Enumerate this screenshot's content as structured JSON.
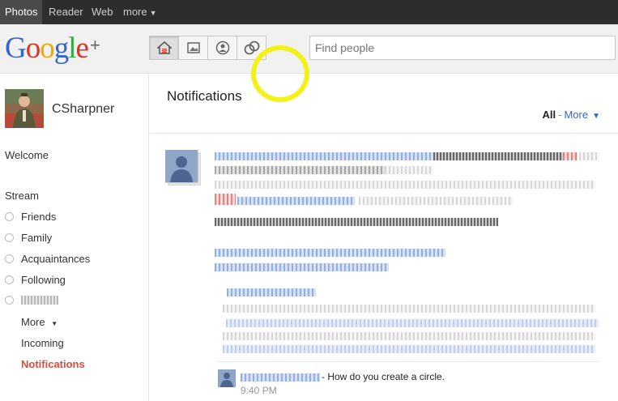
{
  "topbar": {
    "items": [
      {
        "label": "Photos",
        "active": true
      },
      {
        "label": "Reader",
        "active": false
      },
      {
        "label": "Web",
        "active": false
      },
      {
        "label": "more",
        "active": false
      }
    ]
  },
  "header": {
    "logo": {
      "g1": "G",
      "o1": "o",
      "o2": "o",
      "g2": "g",
      "l": "l",
      "e": "e",
      "plus": "+"
    },
    "nav_icons": [
      "home-icon",
      "photos-icon",
      "profile-icon",
      "circles-icon"
    ],
    "active_nav": "home-icon",
    "search_placeholder": "Find people",
    "highlight_color": "#f2f218"
  },
  "sidebar": {
    "profile_name": "CSharpner",
    "welcome": "Welcome",
    "stream": "Stream",
    "circles": [
      "Friends",
      "Family",
      "Acquaintances",
      "Following"
    ],
    "more": "More",
    "incoming": "Incoming",
    "notifications": "Notifications"
  },
  "main": {
    "title": "Notifications",
    "filter_all": "All",
    "filter_sep": "-",
    "filter_more": "More",
    "comment_text": "- How do you create a circle.",
    "comment_time": "9:40 PM"
  },
  "colors": {
    "accent_red": "#dd4b39",
    "link_blue": "#3366cc"
  }
}
